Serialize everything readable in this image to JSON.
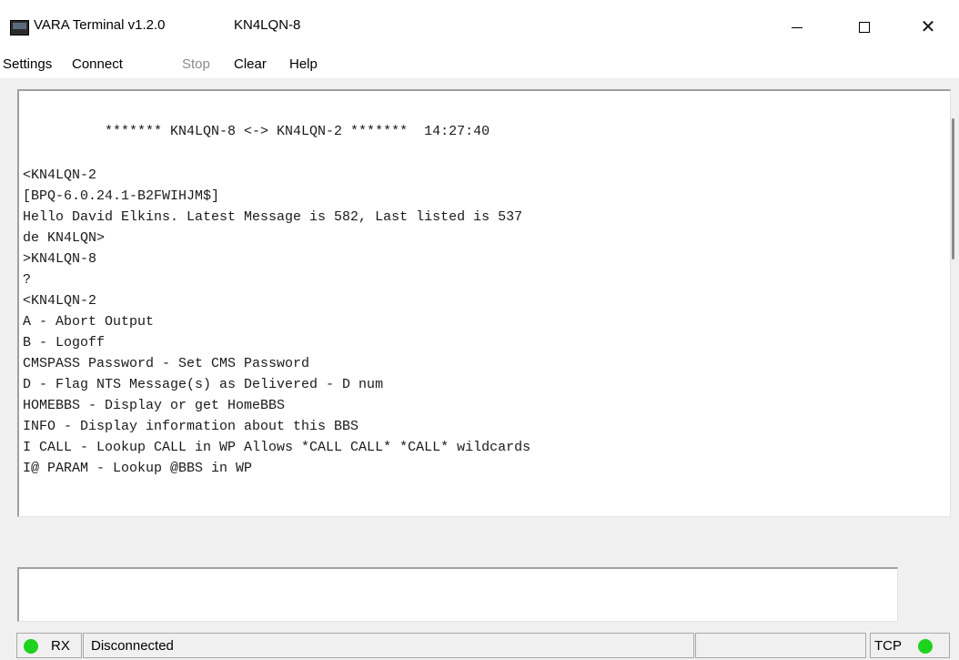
{
  "window": {
    "title": "VARA Terminal v1.2.0",
    "callsign": "KN4LQN-8",
    "controls": {
      "minimize": "—",
      "maximize": "☐",
      "close": "✕"
    }
  },
  "menu": {
    "items": [
      {
        "label": "Settings",
        "enabled": true
      },
      {
        "label": "Connect",
        "enabled": true
      },
      {
        "label": "Stop",
        "enabled": false
      },
      {
        "label": "Clear",
        "enabled": true
      },
      {
        "label": "Help",
        "enabled": true
      }
    ]
  },
  "terminal": {
    "lines": [
      "          ******* KN4LQN-8 <-> KN4LQN-2 *******  14:27:40",
      "",
      "<KN4LQN-2",
      "[BPQ-6.0.24.1-B2FWIHJM$]",
      "Hello David Elkins. Latest Message is 582, Last listed is 537",
      "de KN4LQN>",
      ">KN4LQN-8",
      "?",
      "<KN4LQN-2",
      "A - Abort Output",
      "B - Logoff",
      "CMSPASS Password - Set CMS Password",
      "D - Flag NTS Message(s) as Delivered - D num",
      "HOMEBBS - Display or get HomeBBS",
      "INFO - Display information about this BBS",
      "I CALL - Lookup CALL in WP Allows *CALL CALL* *CALL* wildcards",
      "I@ PARAM - Lookup @BBS in WP"
    ]
  },
  "input": {
    "value": ""
  },
  "status": {
    "rx_label": "RX",
    "connection": "Disconnected",
    "tcp_label": "TCP",
    "led_color": "#1ed21e"
  }
}
